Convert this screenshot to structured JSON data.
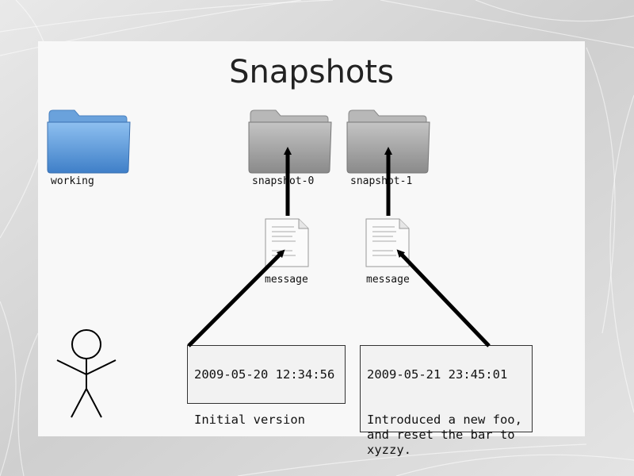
{
  "slide": {
    "title": "Snapshots"
  },
  "folders": {
    "working": {
      "label": "working",
      "color": "#5b9ad6"
    },
    "snapshot0": {
      "label": "snapshot-0",
      "color": "#a8a8a8"
    },
    "snapshot1": {
      "label": "snapshot-1",
      "color": "#a8a8a8"
    }
  },
  "messages": {
    "m0": {
      "label": "message"
    },
    "m1": {
      "label": "message"
    }
  },
  "notes": {
    "n0": {
      "timestamp": "2009-05-20 12:34:56",
      "text": "Initial version"
    },
    "n1": {
      "timestamp": "2009-05-21 23:45:01",
      "text": "Introduced a new foo,\nand reset the bar to\nxyzzy."
    }
  },
  "icons": [
    "folder-icon",
    "document-icon",
    "stick-figure-icon",
    "arrow-icon"
  ]
}
